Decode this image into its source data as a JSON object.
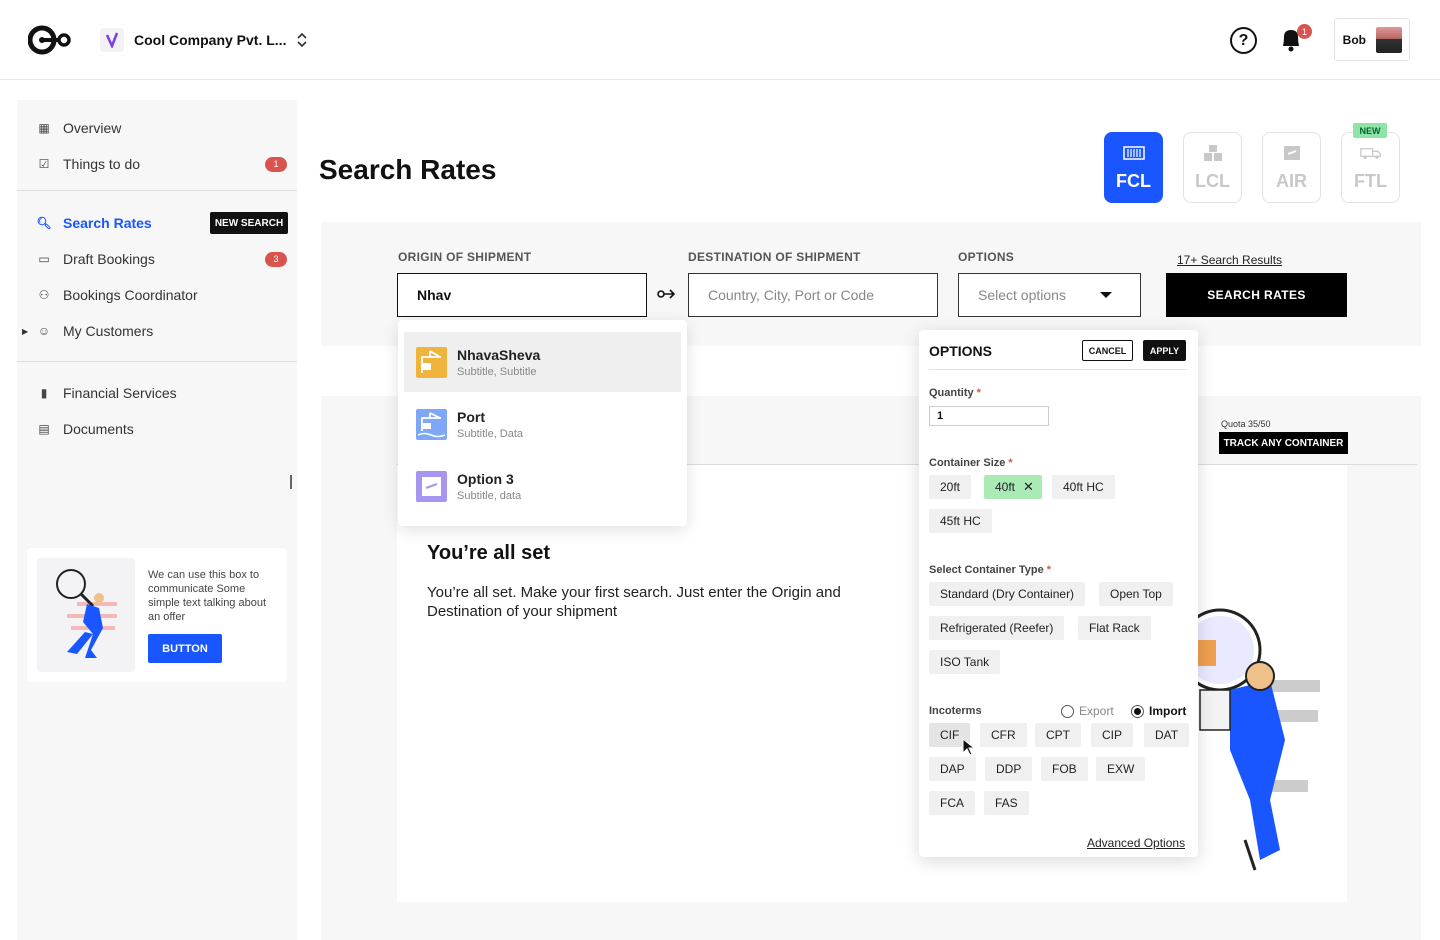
{
  "header": {
    "company": "Cool Company Pvt. L...",
    "help_icon": "?",
    "notification_count": "1",
    "user_name": "Bob"
  },
  "sidebar": {
    "items": [
      {
        "label": "Overview"
      },
      {
        "label": "Things to do",
        "badge": "1"
      },
      {
        "label": "Search Rates",
        "tag": "NEW SEARCH"
      },
      {
        "label": "Draft Bookings",
        "badge": "3"
      },
      {
        "label": "Bookings Coordinator"
      },
      {
        "label": "My Customers"
      },
      {
        "label": "Financial Services"
      },
      {
        "label": "Documents"
      }
    ],
    "promo": {
      "text": "We can use this box to communicate Some simple text talking about an offer",
      "button": "BUTTON"
    }
  },
  "page": {
    "title": "Search Rates",
    "modes": [
      {
        "label": "FCL",
        "active": true
      },
      {
        "label": "LCL"
      },
      {
        "label": "AIR"
      },
      {
        "label": "FTL",
        "tag": "NEW"
      }
    ]
  },
  "search": {
    "origin_label": "ORIGIN OF SHIPMENT",
    "origin_value": "Nhav",
    "destination_label": "DESTINATION OF SHIPMENT",
    "destination_placeholder": "Country, City, Port or Code",
    "options_label": "OPTIONS",
    "options_placeholder": "Select options",
    "results_link": "17+ Search Results",
    "button": "SEARCH RATES"
  },
  "suggestions": [
    {
      "title": "NhavaSheva",
      "subtitle": "Subtitle, Subtitle"
    },
    {
      "title": "Port",
      "subtitle": "Subtitle, Data"
    },
    {
      "title": "Option 3",
      "subtitle": "Subtitle, data"
    }
  ],
  "options_panel": {
    "title": "OPTIONS",
    "cancel": "CANCEL",
    "apply": "APPLY",
    "quantity_label": "Quantity",
    "quantity_value": "1",
    "container_size_label": "Container Size",
    "container_sizes": [
      "20ft",
      "40ft",
      "40ft HC",
      "45ft HC"
    ],
    "container_type_label": "Select Container Type",
    "container_types": [
      "Standard (Dry Container)",
      "Open Top",
      "Refrigerated (Reefer)",
      "Flat Rack",
      "ISO Tank"
    ],
    "incoterms_label": "Incoterms",
    "export_label": "Export",
    "import_label": "Import",
    "incoterms": [
      "CIF",
      "CFR",
      "CPT",
      "CIP",
      "DAT",
      "DAP",
      "DDP",
      "FOB",
      "EXW",
      "FCA",
      "FAS"
    ],
    "advanced": "Advanced Options"
  },
  "main": {
    "quota": "Quota 35/50",
    "track_button": "TRACK ANY CONTAINER",
    "empty_title": "You’re all set",
    "empty_text": "You’re all set. Make your first search. Just enter the Origin and Destination of your shipment"
  }
}
